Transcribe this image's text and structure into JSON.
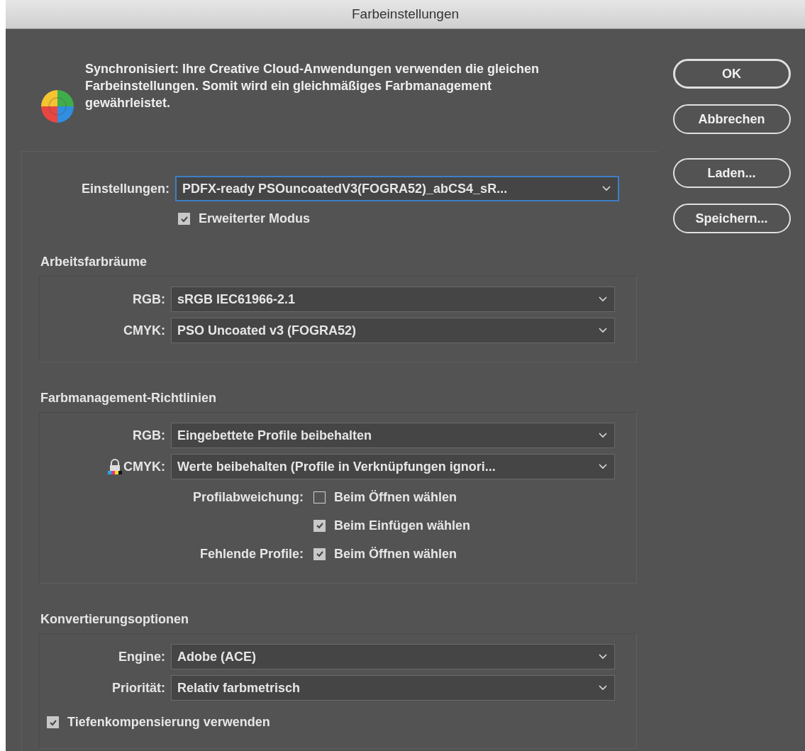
{
  "window": {
    "title": "Farbeinstellungen"
  },
  "message": "Synchronisiert: Ihre Creative Cloud-Anwendungen verwenden die gleichen Farbeinstellungen. Somit wird ein gleichmäßiges Farbmanagement gewährleistet.",
  "settings": {
    "label": "Einstellungen:",
    "value": "PDFX-ready PSOuncoatedV3(FOGRA52)_abCS4_sR...",
    "focused": true
  },
  "advanced_mode": {
    "label": "Erweiterter Modus",
    "checked": true
  },
  "groups": [
    {
      "title": "Arbeitsfarbräume",
      "rows": [
        {
          "kind": "select",
          "label": "RGB:",
          "value": "sRGB IEC61966-2.1",
          "locked": false
        },
        {
          "kind": "select",
          "label": "CMYK:",
          "value": "PSO Uncoated v3 (FOGRA52)",
          "locked": false
        }
      ]
    },
    {
      "title": "Farbmanagement-Richtlinien",
      "rows": [
        {
          "kind": "select",
          "label": "RGB:",
          "value": "Eingebettete Profile beibehalten",
          "locked": false
        },
        {
          "kind": "select",
          "label": "CMYK:",
          "value": "Werte beibehalten (Profile in Verknüpfungen ignori...",
          "locked": true
        },
        {
          "kind": "checkbox",
          "label": "Profilabweichung:",
          "option": "Beim Öffnen wählen",
          "checked": false
        },
        {
          "kind": "checkbox",
          "option": "Beim Einfügen wählen",
          "checked": true
        },
        {
          "kind": "checkbox",
          "label": "Fehlende Profile:",
          "option": "Beim Öffnen wählen",
          "checked": true
        }
      ]
    },
    {
      "title": "Konvertierungsoptionen",
      "rows": [
        {
          "kind": "select",
          "label": "Engine:",
          "value": "Adobe (ACE)",
          "locked": false
        },
        {
          "kind": "select",
          "label": "Priorität:",
          "value": "Relativ farbmetrisch",
          "locked": false
        },
        {
          "kind": "wide_checkbox",
          "option": "Tiefenkompensierung verwenden",
          "checked": true
        }
      ]
    }
  ],
  "buttons": [
    {
      "label": "OK",
      "default": true
    },
    {
      "label": "Abbrechen",
      "default": false
    },
    {
      "label": "Laden...",
      "default": false
    },
    {
      "label": "Speichern...",
      "default": false
    }
  ]
}
